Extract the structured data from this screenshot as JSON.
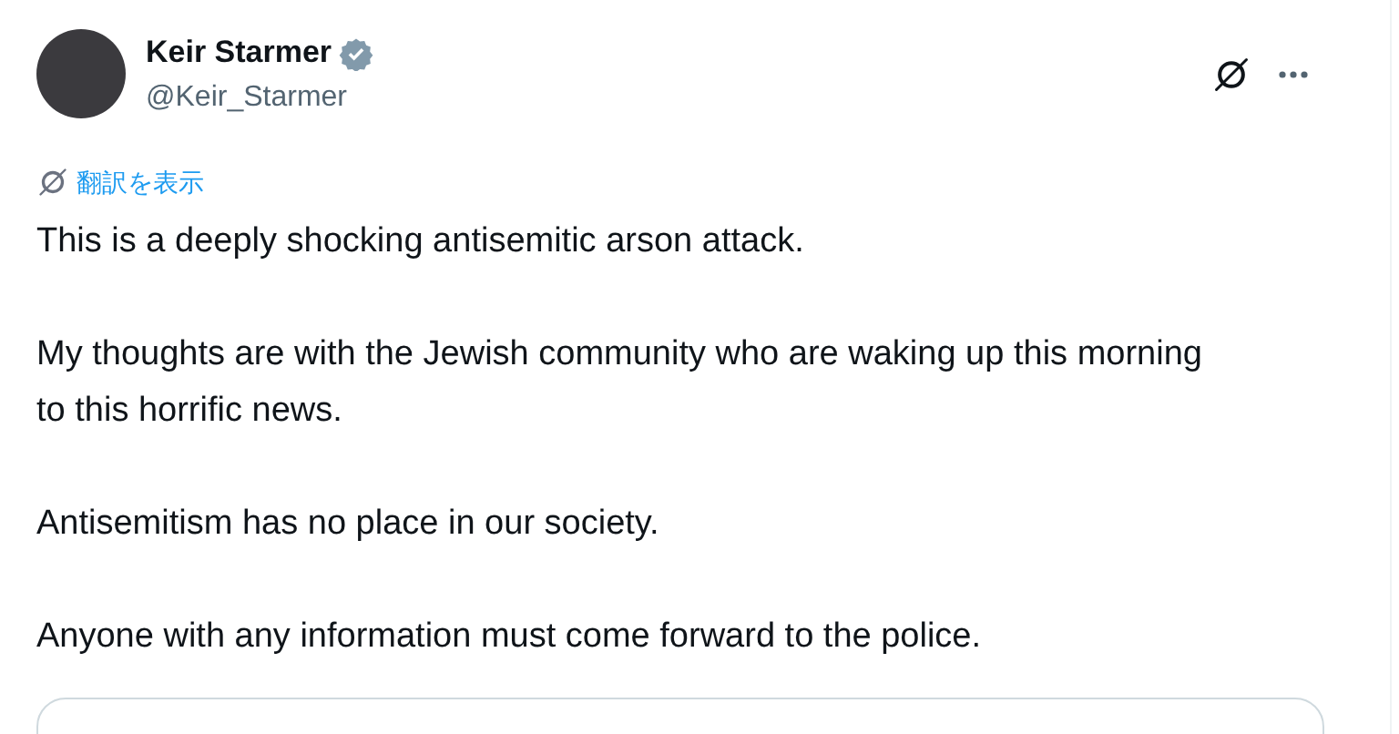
{
  "author": {
    "name": "Keir Starmer",
    "handle": "@Keir_Starmer",
    "verified": true
  },
  "translate_link": "翻訳を表示",
  "paragraphs": [
    "This is a deeply shocking antisemitic arson attack.",
    "My thoughts are with the Jewish community who are waking up this morning to this horrific news.",
    "Antisemitism has no place in our society.",
    "Anyone with any information must come forward to the police."
  ]
}
